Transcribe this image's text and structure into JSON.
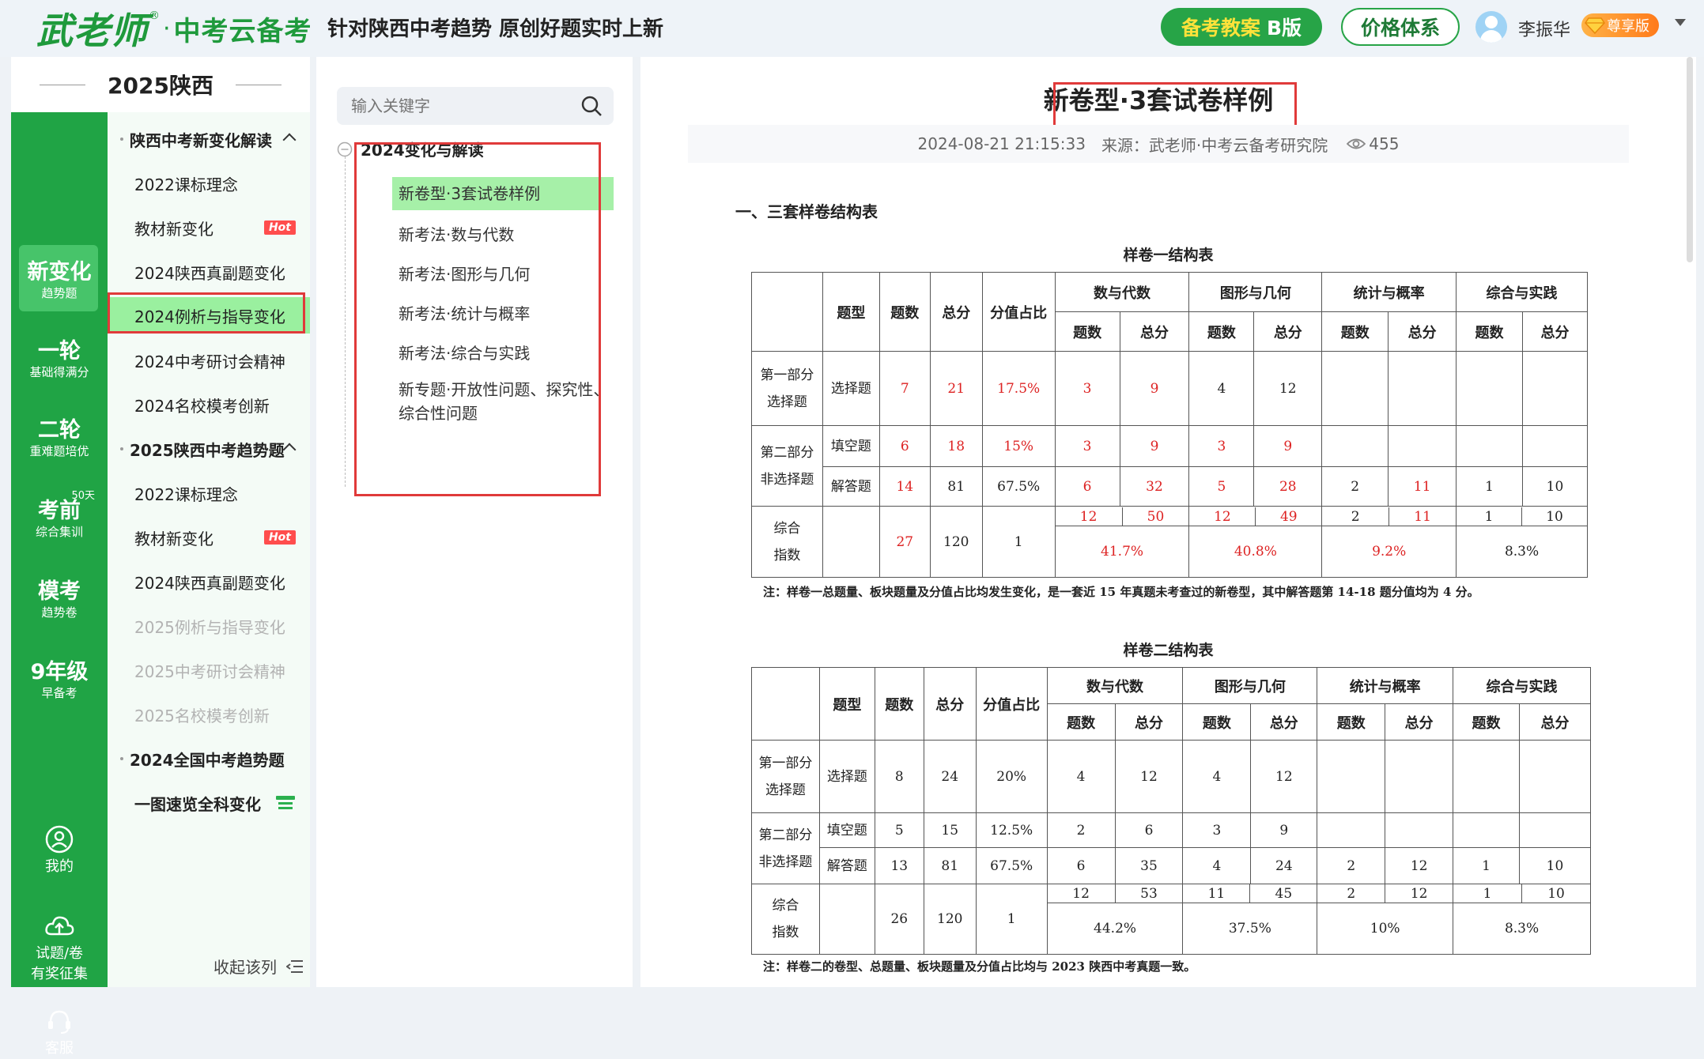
{
  "header": {
    "logo_main": "武老师",
    "logo_reg": "®",
    "logo_dot": "·",
    "logo_sub": "中考云备考",
    "tagline": "针对陕西中考趋势 原创好题实时上新",
    "plan_button_bold": "备考教案",
    "plan_button_suffix": "B版",
    "price_button": "价格体系",
    "username": "李振华",
    "vip_label": "尊享版",
    "user_icon": "avatar-icon",
    "vip_icon": "diamond-icon"
  },
  "left": {
    "region_title": "2025陕西",
    "rail": [
      {
        "big": "新变化",
        "small": "趋势题"
      },
      {
        "big": "一轮",
        "small": "基础得满分"
      },
      {
        "big": "二轮",
        "small": "重难题培优"
      },
      {
        "big": "考前",
        "small": "综合集训",
        "badge": "50天"
      },
      {
        "big": "模考",
        "small": "趋势卷"
      },
      {
        "big": "9年级",
        "small": "早备考"
      }
    ],
    "rail_bottom": [
      {
        "label": "我的",
        "icon": "user-circle-icon"
      },
      {
        "label": "试题/卷",
        "label2": "有奖征集",
        "icon": "cloud-upload-icon"
      },
      {
        "label": "客服",
        "icon": "headset-icon"
      }
    ],
    "catalog": [
      {
        "label": "陕西中考新变化解读",
        "type": "group"
      },
      {
        "label": "2022课标理念"
      },
      {
        "label": "教材新变化",
        "hot": "Hot"
      },
      {
        "label": "2024陕西真副题变化"
      },
      {
        "label": "2024例析与指导变化",
        "selected": true
      },
      {
        "label": "2024中考研讨会精神"
      },
      {
        "label": "2024名校模考创新"
      },
      {
        "label": "2025陕西中考趋势题",
        "type": "group"
      },
      {
        "label": "2022课标理念"
      },
      {
        "label": "教材新变化",
        "hot": "Hot"
      },
      {
        "label": "2024陕西真副题变化"
      },
      {
        "label": "2025例析与指导变化",
        "dim": true
      },
      {
        "label": "2025中考研讨会精神",
        "dim": true
      },
      {
        "label": "2025名校模考创新",
        "dim": true
      },
      {
        "label": "2024全国中考趋势题",
        "type": "group"
      },
      {
        "label": "一图速览全科变化",
        "type": "group-plain"
      }
    ],
    "collapse_label": "收起该列"
  },
  "middle": {
    "search_placeholder": "输入关键字",
    "tree_root": "2024变化与解读",
    "tree_items": [
      "新卷型·3套试卷样例",
      "新考法·数与代数",
      "新考法·图形与几何",
      "新考法·统计与概率",
      "新考法·综合与实践",
      "新专题·开放性问题、探究性、",
      "综合性问题"
    ]
  },
  "article": {
    "title": "新卷型·3套试卷样例",
    "date": "2024-08-21 21:15:33",
    "source": "来源：武老师·中考云备考研究院",
    "views": "455",
    "section_heading": "一、三套样卷结构表",
    "col_headers": {
      "type": "题型",
      "count": "题数",
      "total": "总分",
      "ratio": "分值占比",
      "g1": "数与代数",
      "g2": "图形与几何",
      "g3": "统计与概率",
      "g4": "综合与实践",
      "sub_count": "题数",
      "sub_total": "总分"
    },
    "row_labels": {
      "part1_a": "第一部分",
      "part1_b": "选择题",
      "part2_a": "第二部分",
      "part2_b": "非选择题",
      "sum_a": "综合",
      "sum_b": "指数",
      "choice": "选择题",
      "fill": "填空题",
      "answer": "解答题"
    },
    "table1": {
      "caption": "样卷一结构表",
      "choice": [
        "7",
        "21",
        "17.5%",
        "3",
        "9",
        "4",
        "12",
        "",
        "",
        "",
        ""
      ],
      "fill": [
        "6",
        "18",
        "15%",
        "3",
        "9",
        "3",
        "9",
        "",
        "",
        "",
        ""
      ],
      "answer": [
        "14",
        "81",
        "67.5%",
        "6",
        "32",
        "5",
        "28",
        "2",
        "11",
        "1",
        "10"
      ],
      "sum": [
        "27",
        "120",
        "1"
      ],
      "sum_top": [
        "12",
        "50",
        "12",
        "49",
        "2",
        "11",
        "1",
        "10"
      ],
      "sum_pct": [
        "41.7%",
        "40.8%",
        "9.2%",
        "8.3%"
      ],
      "note": "注：样卷一总题量、板块题量及分值占比均发生变化，是一套近 15 年真题未考查过的新卷型，其中解答题第 14-18 题分值均为 4 分。"
    },
    "table2": {
      "caption": "样卷二结构表",
      "choice": [
        "8",
        "24",
        "20%",
        "4",
        "12",
        "4",
        "12",
        "",
        "",
        "",
        ""
      ],
      "fill": [
        "5",
        "15",
        "12.5%",
        "2",
        "6",
        "3",
        "9",
        "",
        "",
        "",
        ""
      ],
      "answer": [
        "13",
        "81",
        "67.5%",
        "6",
        "35",
        "4",
        "24",
        "2",
        "12",
        "1",
        "10"
      ],
      "sum": [
        "26",
        "120",
        "1"
      ],
      "sum_top": [
        "12",
        "53",
        "11",
        "45",
        "2",
        "12",
        "1",
        "10"
      ],
      "sum_pct": [
        "44.2%",
        "37.5%",
        "10%",
        "8.3%"
      ],
      "note": "注：样卷二的卷型、总题量、板块题量及分值占比均与 2023 陕西中考真题一致。"
    }
  },
  "colors": {
    "brand_green": "#20a445",
    "selected_green": "#9af09f",
    "highlight_red": "#e03a3a",
    "value_red": "#dd2222"
  }
}
